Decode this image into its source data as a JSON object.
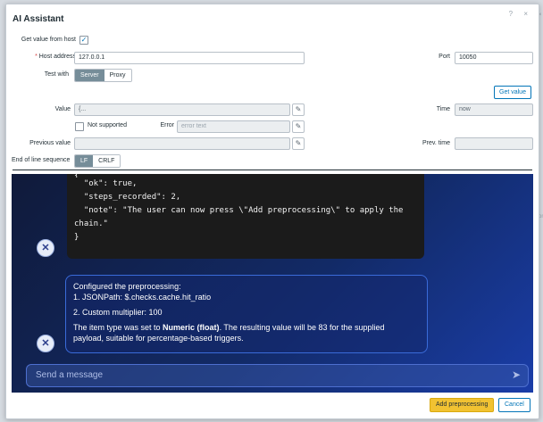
{
  "dialog": {
    "title": "AI Assistant",
    "help_icon": "?",
    "close_icon": "×"
  },
  "form": {
    "get_value_from_host_label": "Get value from host",
    "get_value_from_host_checked": true,
    "host_address_label": "Host address",
    "host_address_value": "127.0.0.1",
    "port_label": "Port",
    "port_value": "10050",
    "test_with_label": "Test with",
    "test_with_options": [
      "Server",
      "Proxy"
    ],
    "test_with_selected": "Server",
    "get_value_button": "Get value",
    "value_label": "Value",
    "value_value": "{...",
    "time_label": "Time",
    "time_value": "now",
    "not_supported_label": "Not supported",
    "error_label": "Error",
    "error_placeholder": "error text",
    "previous_value_label": "Previous value",
    "prev_time_label": "Prev. time",
    "eol_label": "End of line sequence",
    "eol_options": [
      "LF",
      "CRLF"
    ],
    "eol_selected": "LF"
  },
  "chat": {
    "code_lines": [
      "{",
      "  \"ok\": true,",
      "  \"steps_recorded\": 2,",
      "  \"note\": \"The user can now press \\\"Add preprocessing\\\" to apply the",
      "chain.\"",
      "}"
    ],
    "message": {
      "line1": "Configured the preprocessing:",
      "line2": "1. JSONPath: $.checks.cache.hit_ratio",
      "line3_prefix": "2. Custom multiplier: ",
      "line3_value": "100",
      "line4_a": "The item type was set to ",
      "line4_b": "Numeric (float)",
      "line4_c": ". The resulting value will be 83 for the supplied",
      "line4_d": "payload, suitable for percentage-based triggers."
    },
    "input_placeholder": "Send a message"
  },
  "footer": {
    "add_preprocessing": "Add preprocessing",
    "cancel": "Cancel"
  },
  "colors": {
    "accent": "#0275b8",
    "primary_button": "#f1c232",
    "chat_bg_dark": "#101a3a",
    "chat_bg_light": "#1a3da8"
  },
  "background": {
    "right_edge_fragment": "on"
  }
}
